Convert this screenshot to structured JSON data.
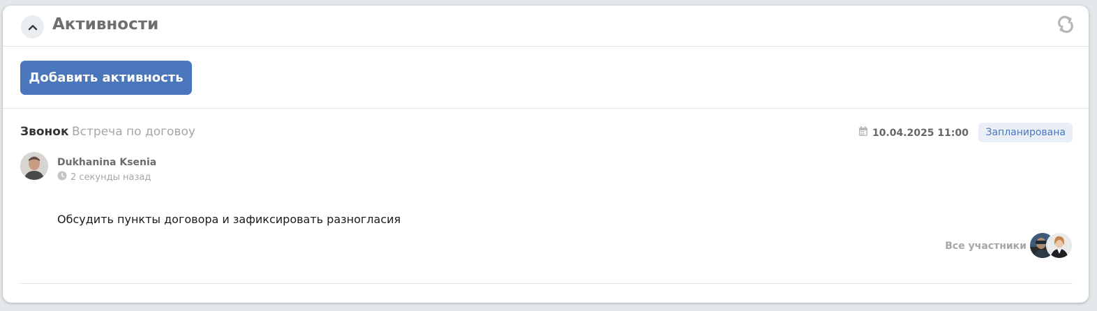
{
  "panel": {
    "title": "Активности",
    "add_button_label": "Добавить активность"
  },
  "activity": {
    "type": "Звонок",
    "subject": "Встреча по договоу",
    "date": "10.04.2025 11:00",
    "status": "Запланирована",
    "author": {
      "name": "Dukhanina Ksenia",
      "time": "2 секунды назад"
    },
    "description": "Обсудить пункты договора и зафиксировать разногласия",
    "participants_label": "Все участники"
  },
  "colors": {
    "accent": "#4a76bc",
    "badge_bg": "#e9eef7",
    "page_bg": "#e3e8ea"
  },
  "icons": [
    "chevron-up-icon",
    "refresh-icon",
    "calendar-icon",
    "clock-icon"
  ]
}
